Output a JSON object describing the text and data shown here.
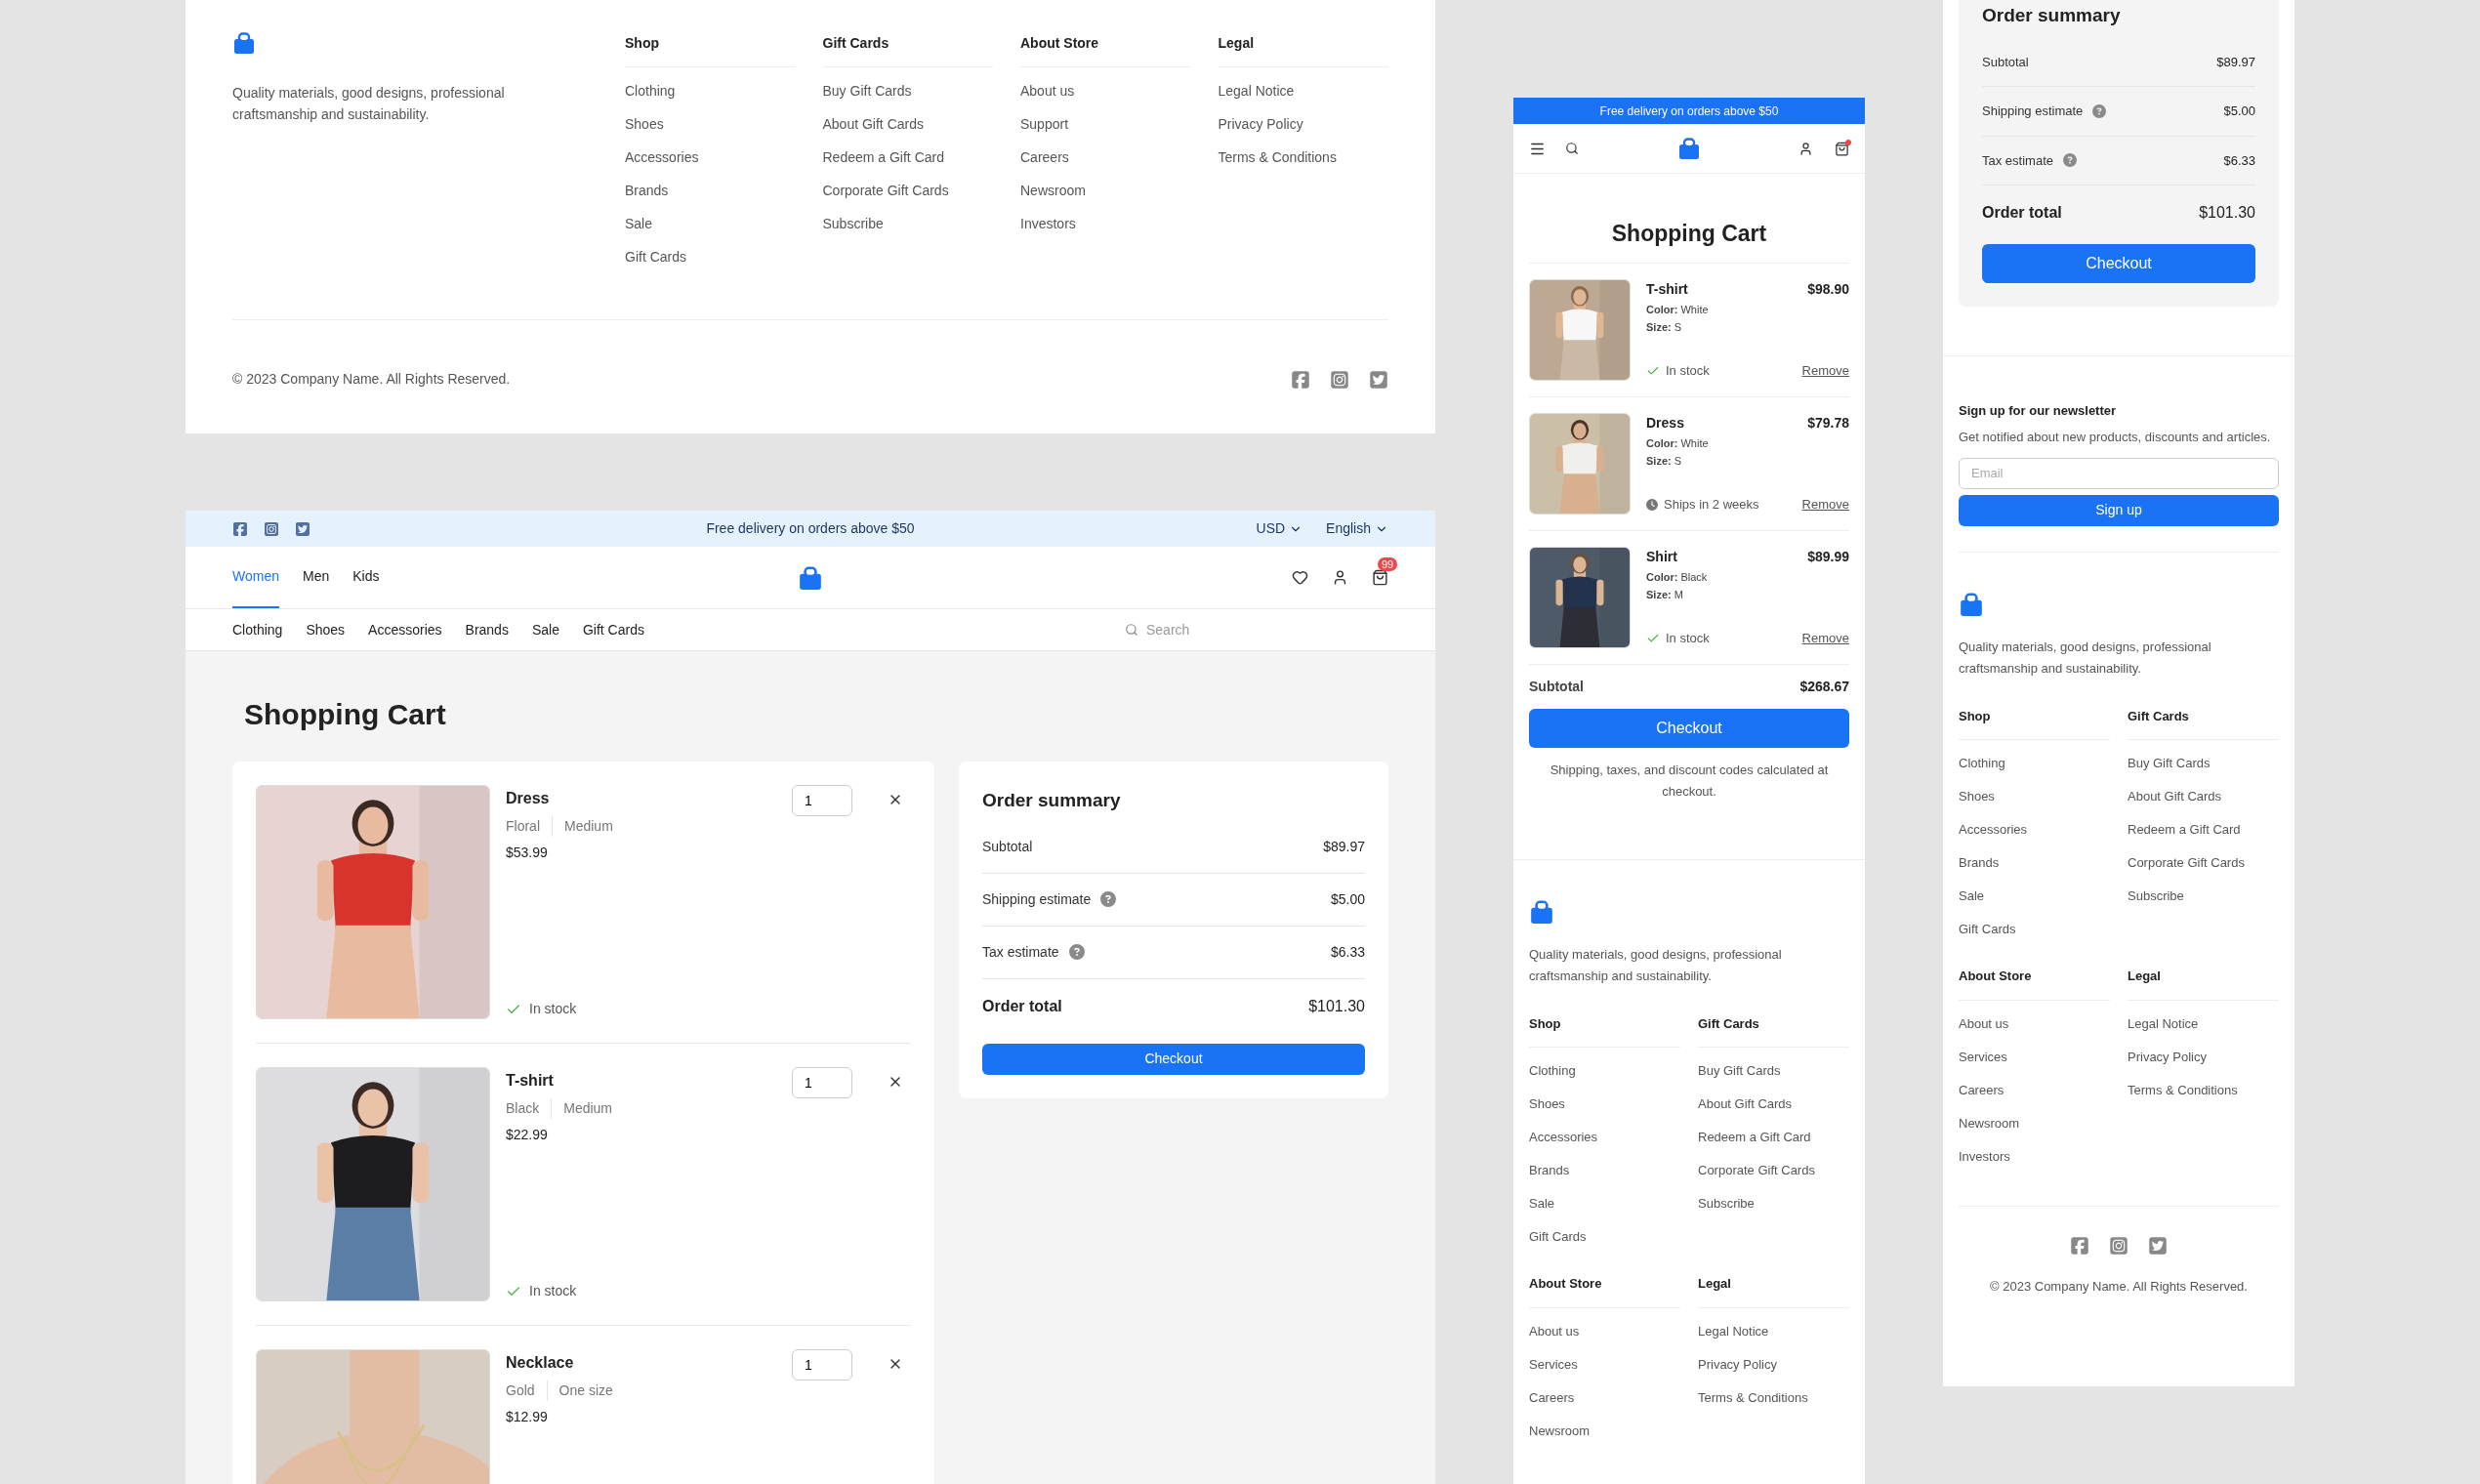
{
  "desktop_footer": {
    "tagline": "Quality materials, good designs, professional craftsmanship and sustainability.",
    "columns": [
      {
        "title": "Shop",
        "links": [
          "Clothing",
          "Shoes",
          "Accessories",
          "Brands",
          "Sale",
          "Gift Cards"
        ]
      },
      {
        "title": "Gift Cards",
        "links": [
          "Buy Gift Cards",
          "About Gift Cards",
          "Redeem a Gift Card",
          "Corporate Gift Cards",
          "Subscribe"
        ]
      },
      {
        "title": "About Store",
        "links": [
          "About us",
          "Support",
          "Careers",
          "Newsroom",
          "Investors"
        ]
      },
      {
        "title": "Legal",
        "links": [
          "Legal Notice",
          "Privacy Policy",
          "Terms & Conditions"
        ]
      }
    ],
    "copyright": "© 2023 Company Name. All Rights Reserved."
  },
  "desktop_cart": {
    "top_bar": {
      "promo": "Free delivery on orders above $50",
      "currency": "USD",
      "language": "English"
    },
    "nav_tabs": [
      {
        "label": "Women",
        "selected": true
      },
      {
        "label": "Men",
        "selected": false
      },
      {
        "label": "Kids",
        "selected": false
      }
    ],
    "cart_count": "99",
    "categories": [
      "Clothing",
      "Shoes",
      "Accessories",
      "Brands",
      "Sale",
      "Gift Cards"
    ],
    "search": {
      "placeholder": "Search"
    },
    "title": "Shopping Cart",
    "items": [
      {
        "name": "Dress",
        "variant": "Floral",
        "size": "Medium",
        "price": "$53.99",
        "quantity": "1",
        "status": "In stock",
        "kind": "in_stock"
      },
      {
        "name": "T-shirt",
        "variant": "Black",
        "size": "Medium",
        "price": "$22.99",
        "quantity": "1",
        "status": "In stock",
        "kind": "in_stock"
      },
      {
        "name": "Necklace",
        "variant": "Gold",
        "size": "One size",
        "price": "$12.99",
        "quantity": "1"
      }
    ],
    "order_summary": {
      "title": "Order summary",
      "rows": [
        {
          "label": "Subtotal",
          "value": "$89.97",
          "help": false
        },
        {
          "label": "Shipping estimate",
          "value": "$5.00",
          "help": true
        },
        {
          "label": "Tax estimate",
          "value": "$6.33",
          "help": true
        }
      ],
      "total_label": "Order total",
      "total_value": "$101.30",
      "button": "Checkout"
    }
  },
  "mobile_cart": {
    "promo": "Free delivery on orders above $50",
    "cart_alert": true,
    "title": "Shopping Cart",
    "items": [
      {
        "name": "T-shirt",
        "price": "$98.90",
        "variant": "**Color:** White",
        "size": "**Size:** S",
        "status": "In stock",
        "kind": "in_stock",
        "action": "Remove"
      },
      {
        "name": "Dress",
        "price": "$79.78",
        "variant": "**Color:** White",
        "size": "**Size:** S",
        "status": "Ships in 2 weeks",
        "kind": "delayed",
        "action": "Remove"
      },
      {
        "name": "Shirt",
        "price": "$89.99",
        "variant": "**Color:** Black",
        "size": "**Size:** M",
        "status": "In stock",
        "kind": "in_stock",
        "action": "Remove"
      }
    ],
    "subtotal_label": "Subtotal",
    "subtotal": "$268.67",
    "button": "Checkout",
    "note": "Shipping, taxes, and discount codes calculated at checkout.",
    "footer": {
      "tagline": "Quality materials, good designs, professional craftsmanship and sustainability.",
      "columns": [
        {
          "title": "Shop",
          "links": [
            "Clothing",
            "Shoes",
            "Accessories",
            "Brands",
            "Sale",
            "Gift Cards"
          ]
        },
        {
          "title": "Gift Cards",
          "links": [
            "Buy Gift Cards",
            "About Gift Cards",
            "Redeem a Gift Card",
            "Corporate Gift Cards",
            "Subscribe"
          ]
        },
        {
          "title": "About Store",
          "links": [
            "About us",
            "Services",
            "Careers",
            "Newsroom"
          ]
        },
        {
          "title": "Legal",
          "links": [
            "Legal Notice",
            "Privacy Policy",
            "Terms & Conditions"
          ]
        }
      ]
    }
  },
  "side_panel": {
    "order_summary": {
      "title": "Order summary",
      "rows": [
        {
          "label": "Subtotal",
          "value": "$89.97",
          "help": false
        },
        {
          "label": "Shipping estimate",
          "value": "$5.00",
          "help": true
        },
        {
          "label": "Tax estimate",
          "value": "$6.33",
          "help": true
        }
      ],
      "total_label": "Order total",
      "total_value": "$101.30",
      "button": "Checkout"
    },
    "newsletter": {
      "title": "Sign up for our newsletter",
      "text": "Get notified about new products, discounts and articles.",
      "placeholder": "Email",
      "button": "Sign up"
    },
    "footer": {
      "tagline": "Quality materials, good designs, professional craftsmanship and sustainability.",
      "columns": [
        {
          "title": "Shop",
          "links": [
            "Clothing",
            "Shoes",
            "Accessories",
            "Brands",
            "Sale",
            "Gift Cards"
          ]
        },
        {
          "title": "Gift Cards",
          "links": [
            "Buy Gift Cards",
            "About Gift Cards",
            "Redeem a Gift Card",
            "Corporate Gift Cards",
            "Subscribe"
          ]
        },
        {
          "title": "About Store",
          "links": [
            "About us",
            "Services",
            "Careers",
            "Newsroom",
            "Investors"
          ]
        },
        {
          "title": "Legal",
          "links": [
            "Legal Notice",
            "Privacy Policy",
            "Terms & Conditions"
          ]
        }
      ],
      "copyright": "© 2023 Company Name. All Rights Reserved."
    }
  }
}
